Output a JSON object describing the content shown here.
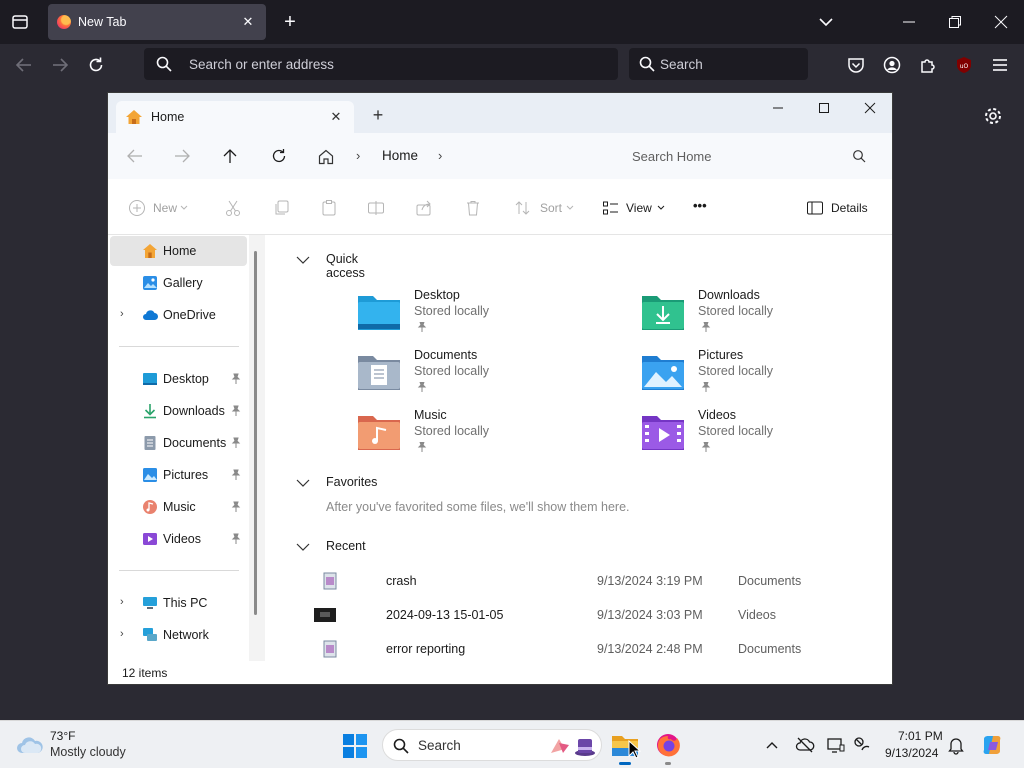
{
  "firefox": {
    "tab_title": "New Tab",
    "new_tab_label": "+",
    "close_label": "✕",
    "url_placeholder": "Search or enter address",
    "search_placeholder": "Search",
    "accent_color": "#ff7139"
  },
  "explorer": {
    "tab_title": "Home",
    "tab_close": "✕",
    "new_tab": "+",
    "breadcrumb": {
      "sep": "›",
      "label": "Home"
    },
    "search_placeholder": "Search Home",
    "commands": {
      "new": "New",
      "sort": "Sort",
      "view": "View",
      "more": "•••",
      "details": "Details"
    },
    "sidebar": {
      "items": [
        {
          "label": "Home",
          "icon": "home-icon"
        },
        {
          "label": "Gallery",
          "icon": "gallery-icon"
        },
        {
          "label": "OneDrive",
          "icon": "onedrive-icon"
        },
        {
          "label": "Desktop",
          "icon": "desktop-folder-icon"
        },
        {
          "label": "Downloads",
          "icon": "downloads-icon"
        },
        {
          "label": "Documents",
          "icon": "documents-icon"
        },
        {
          "label": "Pictures",
          "icon": "pictures-icon"
        },
        {
          "label": "Music",
          "icon": "music-icon"
        },
        {
          "label": "Videos",
          "icon": "videos-icon"
        },
        {
          "label": "This PC",
          "icon": "this-pc-icon"
        },
        {
          "label": "Network",
          "icon": "network-icon"
        }
      ]
    },
    "sections": {
      "quick_access": "Quick access",
      "favorites": "Favorites",
      "favorites_hint": "After you've favorited some files, we'll show them here.",
      "recent": "Recent"
    },
    "quick_access": [
      {
        "name": "Desktop",
        "status": "Stored locally"
      },
      {
        "name": "Downloads",
        "status": "Stored locally"
      },
      {
        "name": "Documents",
        "status": "Stored locally"
      },
      {
        "name": "Pictures",
        "status": "Stored locally"
      },
      {
        "name": "Music",
        "status": "Stored locally"
      },
      {
        "name": "Videos",
        "status": "Stored locally"
      }
    ],
    "recent": [
      {
        "name": "crash",
        "date": "9/13/2024 3:19 PM",
        "location": "Documents"
      },
      {
        "name": "2024-09-13 15-01-05",
        "date": "9/13/2024 3:03 PM",
        "location": "Videos"
      },
      {
        "name": "error reporting",
        "date": "9/13/2024 2:48 PM",
        "location": "Documents"
      }
    ],
    "status": "12 items"
  },
  "taskbar": {
    "weather_temp": "73°F",
    "weather_desc": "Mostly cloudy",
    "search_placeholder": "Search",
    "time": "7:01 PM",
    "date": "9/13/2024"
  }
}
